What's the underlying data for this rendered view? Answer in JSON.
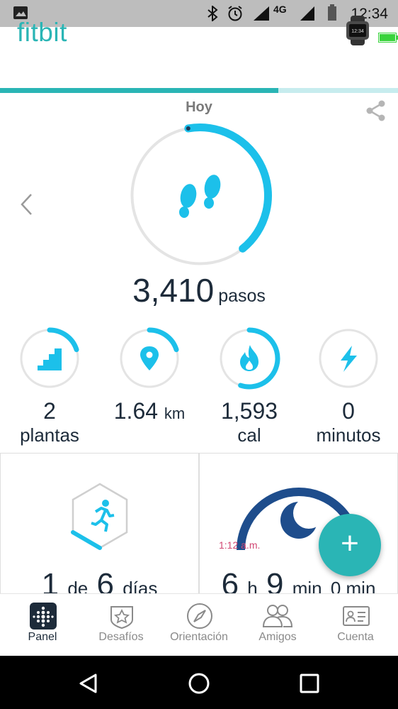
{
  "status_bar": {
    "time": "12:34",
    "network": "4G",
    "icons": [
      "image-icon",
      "bluetooth-icon",
      "alarm-icon",
      "signal-icon",
      "signal-icon",
      "battery-icon"
    ]
  },
  "header": {
    "brand": "fitbit",
    "device_icon": "smartwatch-icon",
    "battery_color": "#39d33c",
    "sync_progress": 0.7
  },
  "dashboard": {
    "day_label": "Hoy",
    "steps": {
      "value": "3,410",
      "unit": "pasos",
      "goal_fraction": 0.42
    },
    "stats": [
      {
        "id": "floors",
        "icon": "stairs-icon",
        "value": "2",
        "unit": "plantas",
        "fraction": 0.2
      },
      {
        "id": "distance",
        "icon": "location-pin-icon",
        "value": "1.64",
        "unit": "km",
        "fraction": 0.2
      },
      {
        "id": "calories",
        "icon": "flame-icon",
        "value": "1,593",
        "unit": "cal",
        "fraction": 0.55
      },
      {
        "id": "active",
        "icon": "lightning-icon",
        "value": "0",
        "unit": "minutos",
        "fraction": 0
      }
    ]
  },
  "cards": {
    "exercise": {
      "value1": "1",
      "word1": "de",
      "value2": "6",
      "word2": "días"
    },
    "sleep": {
      "start_time": "1:12 a.m.",
      "h": "6",
      "h_unit": "h",
      "m": "9",
      "m_unit": "min",
      "extra": "0 min"
    }
  },
  "fab_label": "+",
  "colors": {
    "accent": "#2ab5b5",
    "steps": "#1cc0ea",
    "sleep": "#1e4d8c",
    "sleep_time": "#d24874"
  },
  "bottom_nav": [
    {
      "label": "Panel",
      "icon": "dashboard-icon",
      "active": true
    },
    {
      "label": "Desafíos",
      "icon": "challenges-badge-icon",
      "active": false
    },
    {
      "label": "Orientación",
      "icon": "compass-icon",
      "active": false
    },
    {
      "label": "Amigos",
      "icon": "friends-icon",
      "active": false
    },
    {
      "label": "Cuenta",
      "icon": "account-card-icon",
      "active": false
    }
  ]
}
